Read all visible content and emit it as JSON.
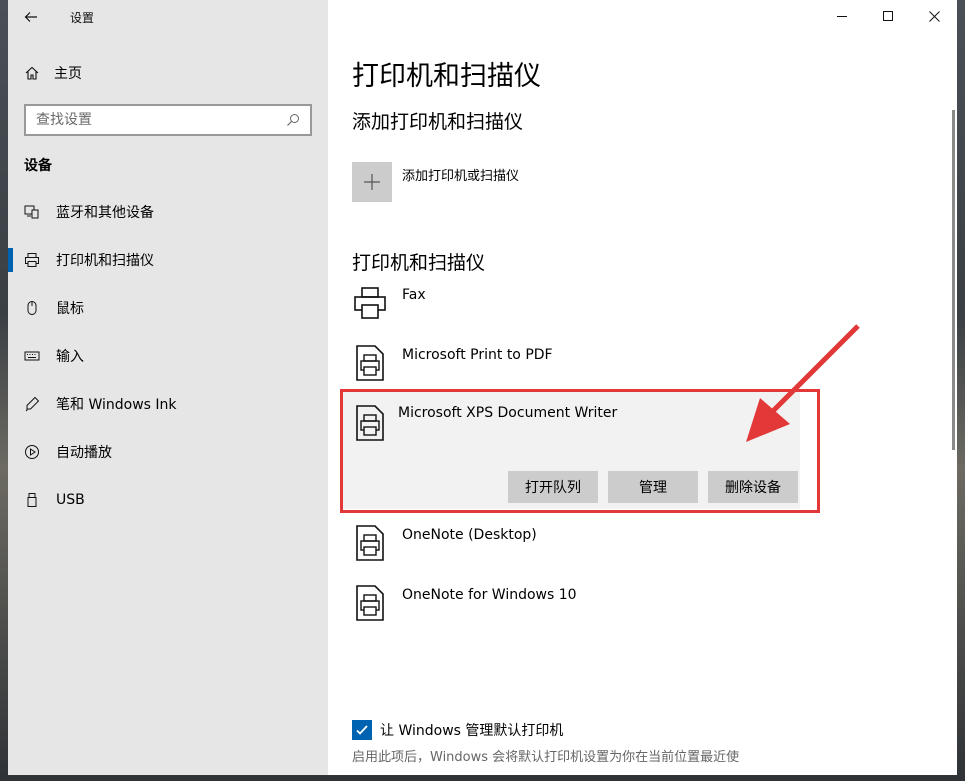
{
  "window": {
    "app_title": "设置"
  },
  "sidebar": {
    "home_label": "主页",
    "search_placeholder": "查找设置",
    "section_title": "设备",
    "items": [
      {
        "label": "蓝牙和其他设备",
        "icon": "bluetooth-devices-icon"
      },
      {
        "label": "打印机和扫描仪",
        "icon": "printer-icon",
        "active": true
      },
      {
        "label": "鼠标",
        "icon": "mouse-icon"
      },
      {
        "label": "输入",
        "icon": "keyboard-icon"
      },
      {
        "label": "笔和 Windows Ink",
        "icon": "pen-icon"
      },
      {
        "label": "自动播放",
        "icon": "autoplay-icon"
      },
      {
        "label": "USB",
        "icon": "usb-icon"
      }
    ]
  },
  "main": {
    "title": "打印机和扫描仪",
    "add_section_title": "添加打印机和扫描仪",
    "add_label": "添加打印机或扫描仪",
    "list_section_title": "打印机和扫描仪",
    "devices": [
      {
        "name": "Fax"
      },
      {
        "name": "Microsoft Print to PDF"
      },
      {
        "name": "Microsoft XPS Document Writer",
        "selected": true
      },
      {
        "name": "OneNote (Desktop)"
      },
      {
        "name": "OneNote for Windows 10"
      }
    ],
    "buttons": {
      "open_queue": "打开队列",
      "manage": "管理",
      "remove": "删除设备"
    },
    "checkbox_label": "让 Windows 管理默认打印机",
    "checkbox_checked": true,
    "checkbox_desc": "启用此项后，Windows 会将默认打印机设置为你在当前位置最近使"
  },
  "colors": {
    "accent": "#0063b1",
    "annotation": "#e23838"
  }
}
